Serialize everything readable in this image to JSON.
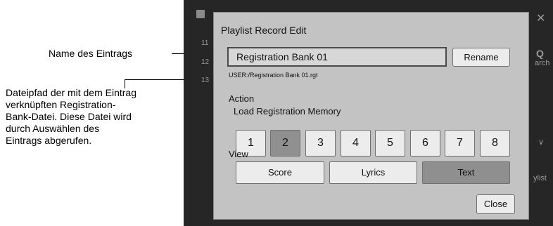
{
  "annotations": {
    "name_label": "Name des Eintrags",
    "path_label": [
      "Dateipfad der mit dem Eintrag",
      "verknüpften Registration-",
      "Bank-Datei. Diese Datei wird",
      "durch Auswählen des",
      "Eintrags abgerufen."
    ]
  },
  "background": {
    "numbers": [
      "11",
      "12",
      "13"
    ],
    "right_labels": [
      "✕",
      "Q",
      "arch",
      "ylist",
      "∨"
    ]
  },
  "dialog": {
    "title": "Playlist Record Edit",
    "entry_name": "Registration Bank 01",
    "rename_label": "Rename",
    "file_path": "USER:/Registration Bank 01.rgt",
    "action_label": "Action",
    "memory_label": "Load Registration Memory",
    "memory_buttons": [
      "1",
      "2",
      "3",
      "4",
      "5",
      "6",
      "7",
      "8"
    ],
    "selected_memory": "2",
    "view_label": "View",
    "view_buttons": [
      "Score",
      "Lyrics",
      "Text"
    ],
    "selected_view": "Text",
    "close_label": "Close"
  }
}
